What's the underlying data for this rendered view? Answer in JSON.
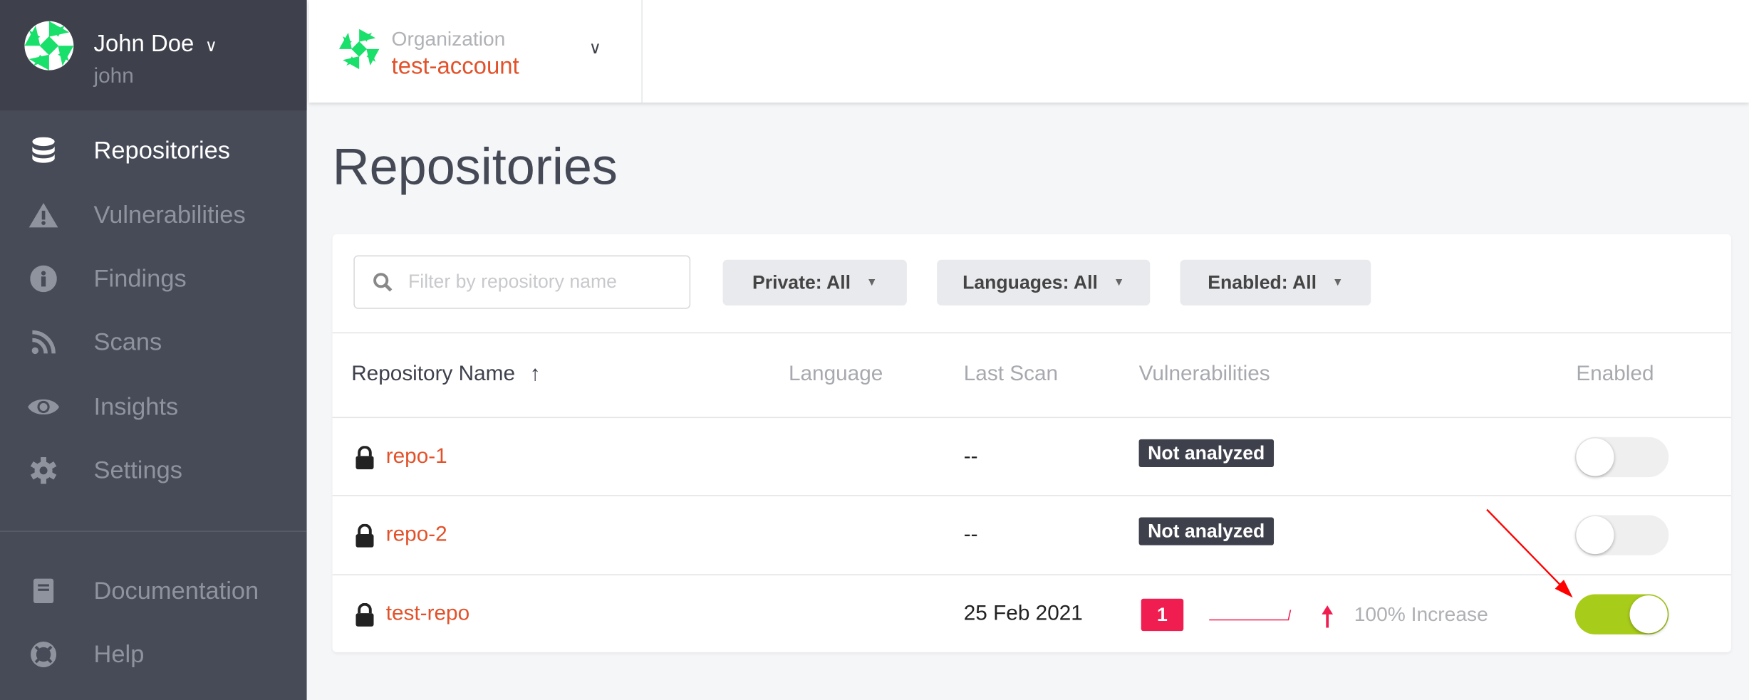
{
  "user": {
    "name": "John Doe",
    "login": "john"
  },
  "sidebar": {
    "items": [
      {
        "label": "Repositories",
        "icon": "database-icon",
        "active": true
      },
      {
        "label": "Vulnerabilities",
        "icon": "warning-icon"
      },
      {
        "label": "Findings",
        "icon": "info-icon"
      },
      {
        "label": "Scans",
        "icon": "rss-icon"
      },
      {
        "label": "Insights",
        "icon": "eye-icon"
      },
      {
        "label": "Settings",
        "icon": "gear-icon"
      }
    ],
    "bottom": [
      {
        "label": "Documentation",
        "icon": "book-icon"
      },
      {
        "label": "Help",
        "icon": "lifebuoy-icon"
      }
    ]
  },
  "org": {
    "label": "Organization",
    "name": "test-account"
  },
  "page": {
    "title": "Repositories"
  },
  "filters": {
    "search_placeholder": "Filter by repository name",
    "private": "Private: All",
    "languages": "Languages: All",
    "enabled": "Enabled: All"
  },
  "table": {
    "columns": [
      "Repository Name",
      "Language",
      "Last Scan",
      "Vulnerabilities",
      "Enabled"
    ],
    "sort_indicator": "↑",
    "rows": [
      {
        "name": "repo-1",
        "language": "",
        "last_scan": "--",
        "vuln": "Not analyzed",
        "enabled": false
      },
      {
        "name": "repo-2",
        "language": "",
        "last_scan": "--",
        "vuln": "Not analyzed",
        "enabled": false
      },
      {
        "name": "test-repo",
        "language": "",
        "last_scan": "25 Feb 2021",
        "vuln_count": "1",
        "trend": "100% Increase",
        "enabled": true
      }
    ]
  },
  "colors": {
    "accent": "#e2522a",
    "toggle_on": "#a8cc1a",
    "critical": "#f01e50",
    "sidebar": "#474b57"
  }
}
